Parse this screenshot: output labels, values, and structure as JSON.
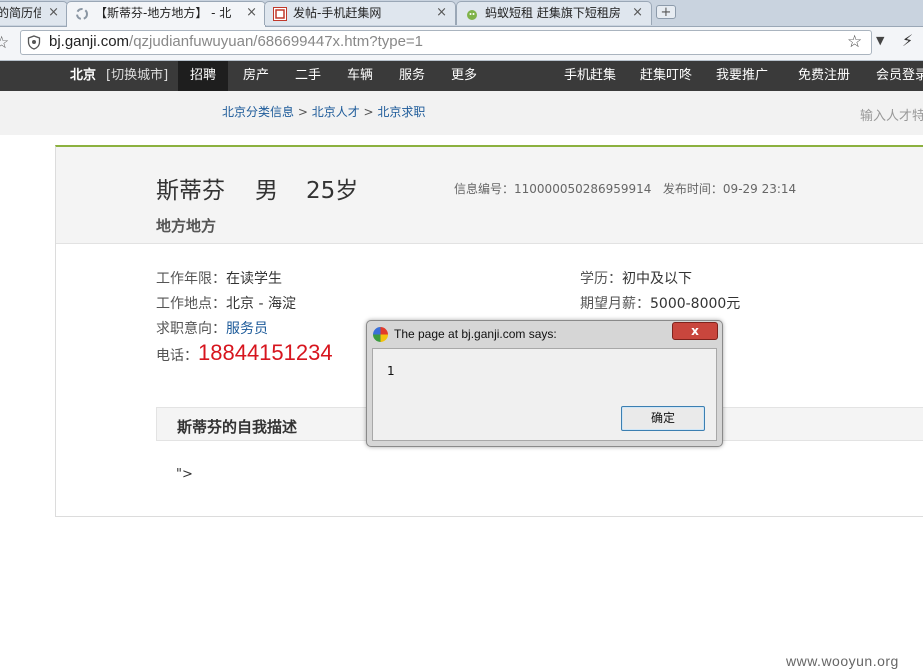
{
  "browser": {
    "tabs": [
      {
        "label": "的简历信",
        "active": false
      },
      {
        "label": "【斯蒂芬-地方地方】 - 北",
        "active": true
      },
      {
        "label": "发帖-手机赶集网",
        "active": false
      },
      {
        "label": "蚂蚁短租 赶集旗下短租房",
        "active": false
      }
    ],
    "close_glyph": "×",
    "new_tab_glyph": "+",
    "url_host": "bj.ganji.com",
    "url_path": "/qzjudianfuwuyuan/686699447x.htm?type=1"
  },
  "site_nav": {
    "city": "北京",
    "switch_city": "[切换城市]",
    "items": [
      "招聘",
      "房产",
      "二手",
      "车辆",
      "服务",
      "更多"
    ],
    "right_items": [
      "手机赶集",
      "赶集叮咚",
      "我要推广",
      "免费注册",
      "会员登录"
    ]
  },
  "breadcrumb": {
    "items": [
      "北京分类信息",
      "北京人才",
      "北京求职"
    ],
    "separator": " > "
  },
  "search_placeholder": "输入人才特",
  "resume": {
    "name": "斯蒂芬",
    "gender": "男",
    "age": "25岁",
    "info_id_label": "信息编号：",
    "info_id": "110000050286959914",
    "publish_label": "发布时间：",
    "publish_time": "09-29 23:14",
    "subtitle": "地方地方",
    "experience_label": "工作年限：",
    "experience": "在读学生",
    "location_label": "工作地点：",
    "location": "北京 - 海淀",
    "job_label": "求职意向：",
    "job": "服务员",
    "phone_label": "电话：",
    "phone": "18844151234",
    "education_label": "学历：",
    "education": "初中及以下",
    "salary_label": "期望月薪：",
    "salary": "5000-8000元",
    "desc_title": "斯蒂芬的自我描述",
    "desc_text": "\">"
  },
  "dialog": {
    "title": "The page at bj.ganji.com says:",
    "close": "x",
    "message": "1",
    "ok": "确定"
  },
  "watermark": "www.wooyun.org",
  "colors": {
    "nav_bg": "#3a3a3a",
    "accent_green": "#8cb13f",
    "link_blue": "#1c5a99",
    "phone_red": "#d7151e",
    "dialog_close_red": "#c9463d"
  }
}
